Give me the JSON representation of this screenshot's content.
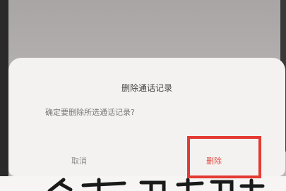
{
  "dialog": {
    "title": "删除通话记录",
    "message": "确定要删除所选通话记录?",
    "cancel_label": "取消",
    "delete_label": "删除"
  },
  "colors": {
    "dialog_bg": "#f4f2f1",
    "delete_text": "#e0564b",
    "highlight": "#e33b33"
  }
}
